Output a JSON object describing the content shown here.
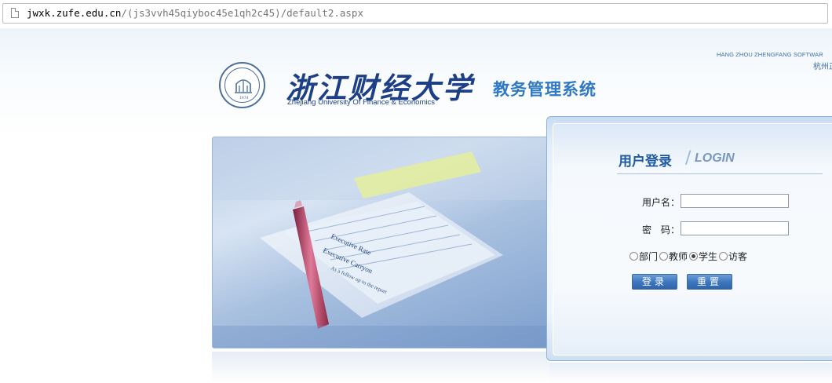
{
  "browser": {
    "url_host": "jwxk.zufe.edu.cn",
    "url_path": "/(js3vvh45qiyboc45e1qh2c45)/default2.aspx"
  },
  "header": {
    "company_en": "HANG ZHOU ZHENGFANG SOFTWAR",
    "company_cn": "杭州正",
    "university_cn": "浙江财经大学",
    "university_en": "Zhejiang University Of Finance & Economics",
    "seal_year": "1974",
    "system_title": "教务管理系统"
  },
  "photo": {
    "paper_text_1": "Executive Rate",
    "paper_text_2": "Executive Carryon",
    "paper_text_3": "As a follow up to the report"
  },
  "login": {
    "title_cn": "用户登录",
    "title_en": "LOGIN",
    "username_label": "用户名：",
    "username_value": "",
    "password_label": "密　码：",
    "password_value": "",
    "roles": [
      {
        "label": "部门",
        "checked": false
      },
      {
        "label": "教师",
        "checked": false
      },
      {
        "label": "学生",
        "checked": true
      },
      {
        "label": "访客",
        "checked": false
      }
    ],
    "login_button": "登录",
    "reset_button": "重置"
  },
  "colors": {
    "brand_blue": "#1d3f86",
    "title_blue": "#2f79c3",
    "button_blue": "#3f78bf"
  }
}
